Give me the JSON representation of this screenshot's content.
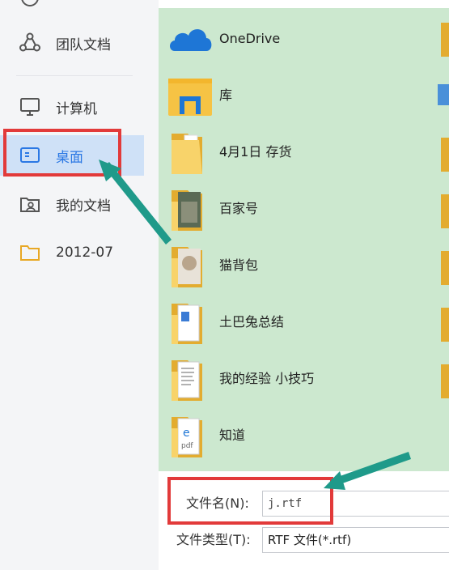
{
  "sidebar": {
    "items": [
      {
        "label": "团队文档",
        "icon": "team-share-icon"
      },
      {
        "label": "计算机",
        "icon": "monitor-icon"
      },
      {
        "label": "桌面",
        "icon": "desktop-icon",
        "selected": true
      },
      {
        "label": "我的文档",
        "icon": "my-documents-icon"
      },
      {
        "label": "2012-07",
        "icon": "folder-icon"
      }
    ]
  },
  "files": [
    {
      "name": "OneDrive",
      "icon": "onedrive-cloud-icon"
    },
    {
      "name": "库",
      "icon": "library-icon"
    },
    {
      "name": "4月1日 存货",
      "icon": "folder-icon"
    },
    {
      "name": "百家号",
      "icon": "folder-photo-icon"
    },
    {
      "name": "猫背包",
      "icon": "folder-photo-icon"
    },
    {
      "name": "土巴兔总结",
      "icon": "folder-docs-icon"
    },
    {
      "name": "我的经验 小技巧",
      "icon": "folder-docs-icon"
    },
    {
      "name": "知道",
      "icon": "folder-pdf-icon"
    }
  ],
  "form": {
    "filename_label": "文件名(N):",
    "filename_value": "j.rtf",
    "filetype_label": "文件类型(T):",
    "filetype_value": "RTF 文件(*.rtf)"
  },
  "colors": {
    "accent": "#2b78e4",
    "selection": "#cfe1f7",
    "list_background": "#cce8cf",
    "highlight_box": "#e23a3a",
    "annotation_arrow": "#1f9a8a",
    "folder": "#f6c344"
  }
}
